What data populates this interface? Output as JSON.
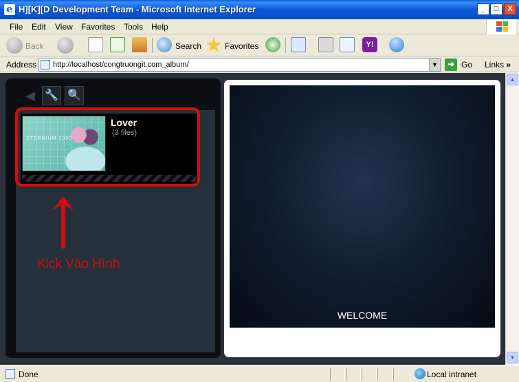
{
  "window": {
    "title": "H][K][D Development Team - Microsoft Internet Explorer",
    "minimize": "_",
    "maximize": "□",
    "close": "X"
  },
  "menu": [
    "File",
    "Edit",
    "View",
    "Favorites",
    "Tools",
    "Help"
  ],
  "toolbar": {
    "back": "Back",
    "search": "Search",
    "favorites": "Favorites"
  },
  "address": {
    "label": "Address",
    "url": "http://localhost/congtruongit.com_album/",
    "go": "Go",
    "links": "Links",
    "links_chevron": "»"
  },
  "gallery": {
    "album_title": "Lover",
    "album_count": "(3 files)",
    "thumb_caption": "STERNIUM 2000"
  },
  "annotation": {
    "text": "Kick Vào Hình",
    "color": "#d40d0d"
  },
  "viewer": {
    "welcome": "WELCOME"
  },
  "status": {
    "text": "Done",
    "zone": "Local intranet"
  }
}
